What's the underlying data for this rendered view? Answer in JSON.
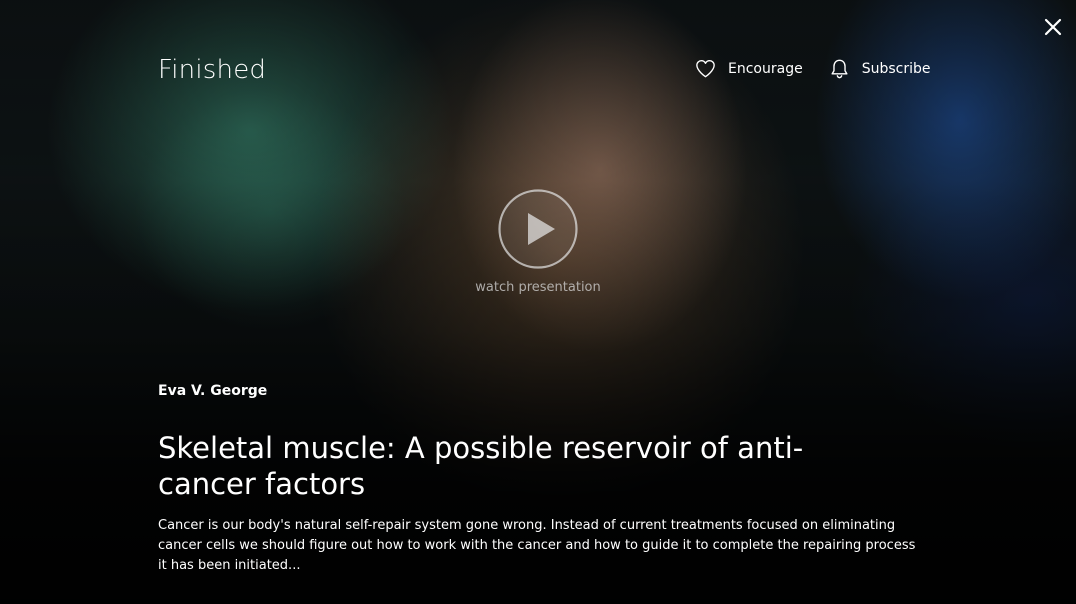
{
  "overlay": {
    "status": "Finished",
    "close_icon": "close-icon"
  },
  "actions": {
    "encourage": {
      "label": "Encourage",
      "icon": "heart-icon"
    },
    "subscribe": {
      "label": "Subscribe",
      "icon": "bell-icon"
    }
  },
  "player": {
    "play_icon": "play-icon",
    "watch_label": "watch presentation"
  },
  "presentation": {
    "speaker": "Eva V. George",
    "title": "Skeletal muscle: A possible reservoir of anti-cancer factors",
    "description": "Cancer is our body's natural self-repair system gone wrong. Instead of current treatments focused on eliminating cancer cells we should figure out how to work with the cancer and how to guide it to complete the repairing process it has been initiated..."
  }
}
